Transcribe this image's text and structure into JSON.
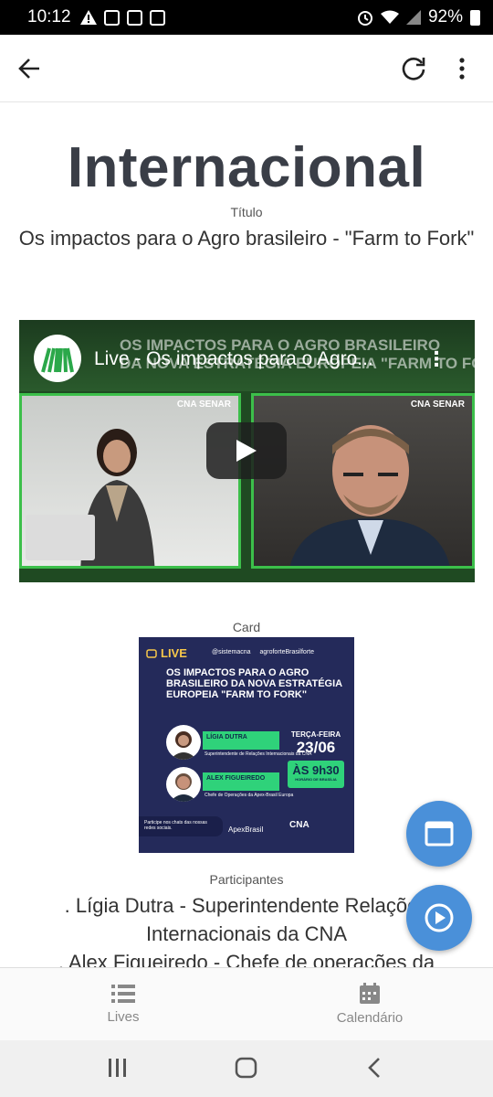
{
  "status_bar": {
    "time": "10:12",
    "battery": "92%"
  },
  "page": {
    "title": "Internacional",
    "title_label": "Título",
    "subject": "Os impactos para o Agro brasileiro - \"Farm to Fork\"",
    "card_label": "Card",
    "participants_label": "Participantes",
    "participants_text": ". Lígia Dutra - Superintendente Relações Internacionais da CNA\n. Alex Figueiredo - Chefe de operações da"
  },
  "video": {
    "title": "Live - Os impactos para o Agro...",
    "banner_line1": "OS IMPACTOS PARA O AGRO BRASILEIRO",
    "banner_line2": "DA NOVA ESTRATÉGIA EUROPEIA \"FARM TO FORK\"",
    "pane_tag": "CNA SENAR"
  },
  "card": {
    "live": "LIVE",
    "handle1": "@sistemacna",
    "handle2": "agroforteBrasilforte",
    "headline": "OS IMPACTOS PARA O AGRO BRASILEIRO DA NOVA ESTRATÉGIA EUROPEIA \"FARM TO FORK\"",
    "p1_name": "LÍGIA DUTRA",
    "p1_role": "Superintendente de Relações Internacionais da CNA",
    "p2_name": "ALEX FIGUEIREDO",
    "p2_role": "Chefe de Operações da Apex-Brasil Europa",
    "day": "TERÇA-FEIRA",
    "date": "23/06",
    "hour": "ÀS 9h30",
    "hour_sub": "HORÁRIO DE BRASÍLIA",
    "chat": "Participe nos chats das nossas redes sociais.",
    "apex": "ApexBrasil",
    "cna": "CNA"
  },
  "bottom_nav": [
    {
      "label": "Lives",
      "icon": "list-icon"
    },
    {
      "label": "Calendário",
      "icon": "calendar-icon"
    }
  ],
  "colors": {
    "fab": "#4a90d9",
    "title": "#3a3e47",
    "video_green": "#3cbf4a",
    "card_bg": "#242a5a"
  }
}
